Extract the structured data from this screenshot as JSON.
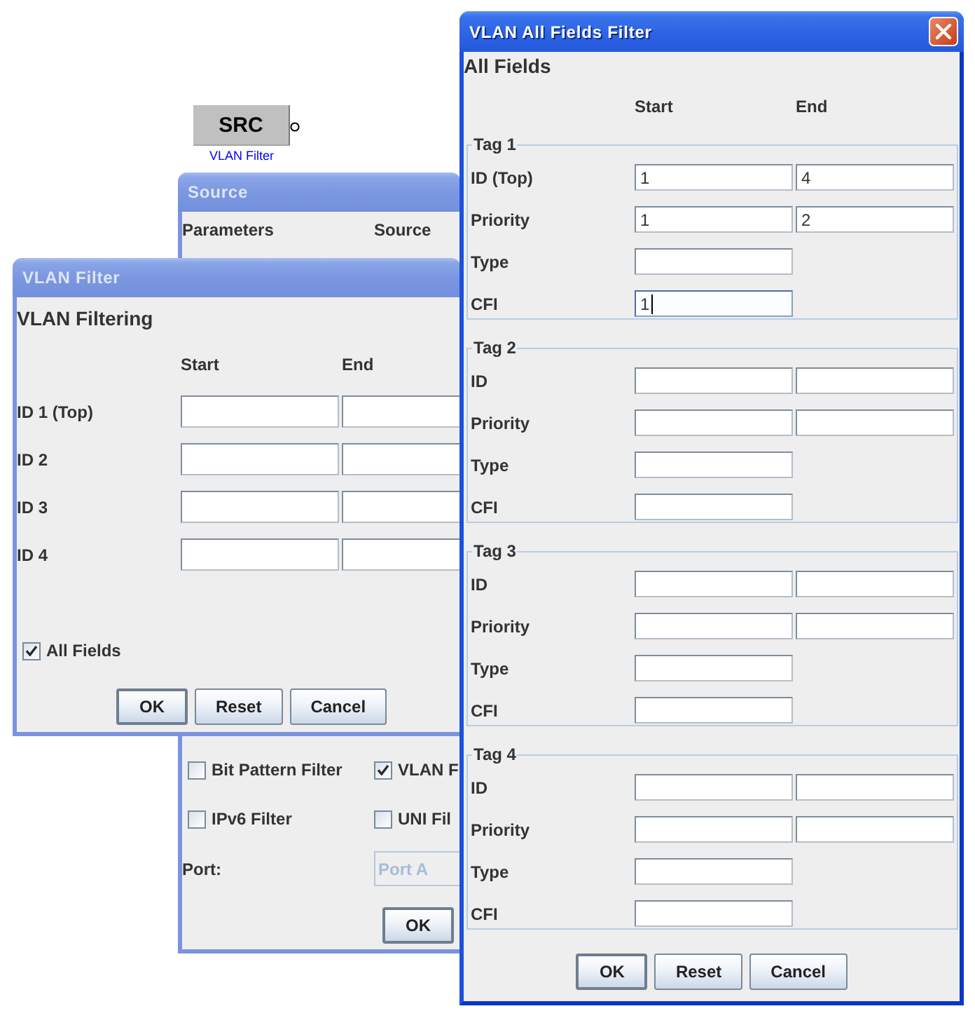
{
  "canvas": {
    "node": {
      "label": "SRC",
      "caption": "VLAN Filter"
    }
  },
  "source_window": {
    "title": "Source",
    "active": false,
    "columns": [
      "Parameters",
      "Source"
    ],
    "filters": [
      {
        "label": "Bit Pattern Filter",
        "checked": false
      },
      {
        "label": "VLAN F",
        "checked": true
      },
      {
        "label": "IPv6 Filter",
        "checked": false
      },
      {
        "label": "UNI Fil",
        "checked": false
      }
    ],
    "port": {
      "label": "Port:",
      "value": "Port A",
      "disabled": true
    },
    "buttons": [
      {
        "label": "OK",
        "default": true
      }
    ]
  },
  "vlan_filter_window": {
    "title": "VLAN Filter",
    "active": false,
    "heading": "VLAN Filtering",
    "columns": [
      "Start",
      "End"
    ],
    "rows": [
      {
        "label": "ID 1 (Top)"
      },
      {
        "label": "ID 2"
      },
      {
        "label": "ID 3"
      },
      {
        "label": "ID 4"
      }
    ],
    "all_fields": {
      "label": "All Fields",
      "checked": true
    },
    "buttons": [
      {
        "label": "OK",
        "default": true
      },
      {
        "label": "Reset",
        "default": false
      },
      {
        "label": "Cancel",
        "default": false
      }
    ]
  },
  "all_fields_window": {
    "title": "VLAN All Fields Filter",
    "active": true,
    "heading": "All Fields",
    "columns": [
      "Start",
      "End"
    ],
    "tags": [
      {
        "title": "Tag 1",
        "rows": [
          {
            "label": "ID (Top)",
            "kind": "range",
            "start": "1",
            "end": "4",
            "focused": false
          },
          {
            "label": "Priority",
            "kind": "range",
            "start": "1",
            "end": "2",
            "focused": false
          },
          {
            "label": "Type",
            "kind": "single",
            "focused": false
          },
          {
            "label": "CFI",
            "kind": "single",
            "start": "1",
            "focused": true
          }
        ]
      },
      {
        "title": "Tag 2",
        "rows": [
          {
            "label": "ID",
            "kind": "range",
            "focused": false
          },
          {
            "label": "Priority",
            "kind": "range",
            "focused": false
          },
          {
            "label": "Type",
            "kind": "single",
            "focused": false
          },
          {
            "label": "CFI",
            "kind": "single",
            "focused": false
          }
        ]
      },
      {
        "title": "Tag 3",
        "rows": [
          {
            "label": "ID",
            "kind": "range",
            "focused": false
          },
          {
            "label": "Priority",
            "kind": "range",
            "focused": false
          },
          {
            "label": "Type",
            "kind": "single",
            "focused": false
          },
          {
            "label": "CFI",
            "kind": "single",
            "focused": false
          }
        ]
      },
      {
        "title": "Tag 4",
        "rows": [
          {
            "label": "ID",
            "kind": "range",
            "focused": false
          },
          {
            "label": "Priority",
            "kind": "range",
            "focused": false
          },
          {
            "label": "Type",
            "kind": "single",
            "focused": false
          },
          {
            "label": "CFI",
            "kind": "single",
            "focused": false
          }
        ]
      }
    ],
    "buttons": [
      {
        "label": "OK",
        "default": true
      },
      {
        "label": "Reset",
        "default": false
      },
      {
        "label": "Cancel",
        "default": false
      }
    ]
  }
}
